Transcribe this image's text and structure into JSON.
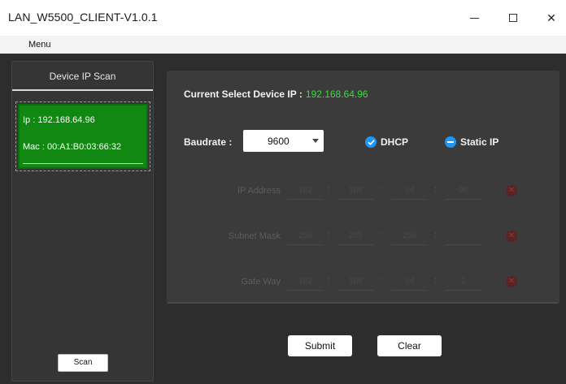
{
  "window": {
    "title": "LAN_W5500_CLIENT-V1.0.1",
    "minimize_glyph": "—",
    "maximize_glyph": "☐",
    "close_glyph": "✕"
  },
  "menu": {
    "items": [
      {
        "label": "Menu"
      }
    ]
  },
  "left_panel": {
    "header": "Device IP Scan",
    "devices": [
      {
        "ip_text": "Ip :  192.168.64.96",
        "mac_text": "Mac : 00:A1:B0:03:66:32"
      }
    ],
    "scan_label": "Scan"
  },
  "config": {
    "current_ip_label": "Current Select Device IP :",
    "current_ip_value": "192.168.64.96",
    "baudrate_label": "Baudrate :",
    "baudrate_value": "9600",
    "dhcp_label": "DHCP",
    "dhcp_selected": true,
    "static_label": "Static IP",
    "static_selected": false,
    "fields": [
      {
        "label": "IP Address",
        "octets": [
          "192",
          "168",
          "64",
          "96"
        ]
      },
      {
        "label": "Subnet Mask",
        "octets": [
          "255",
          "255",
          "255",
          ""
        ]
      },
      {
        "label": "Gate Way",
        "octets": [
          "192",
          "168",
          "64",
          "1"
        ]
      }
    ],
    "error_icon": "✕"
  },
  "actions": {
    "submit_label": "Submit",
    "clear_label": "Clear"
  },
  "colors": {
    "device_selected": "#118811",
    "current_ip_value": "#3ddc3d",
    "radio_accent": "#2196f3",
    "panel_bg": "#3b3b3b",
    "app_bg": "#2d2d2d"
  }
}
